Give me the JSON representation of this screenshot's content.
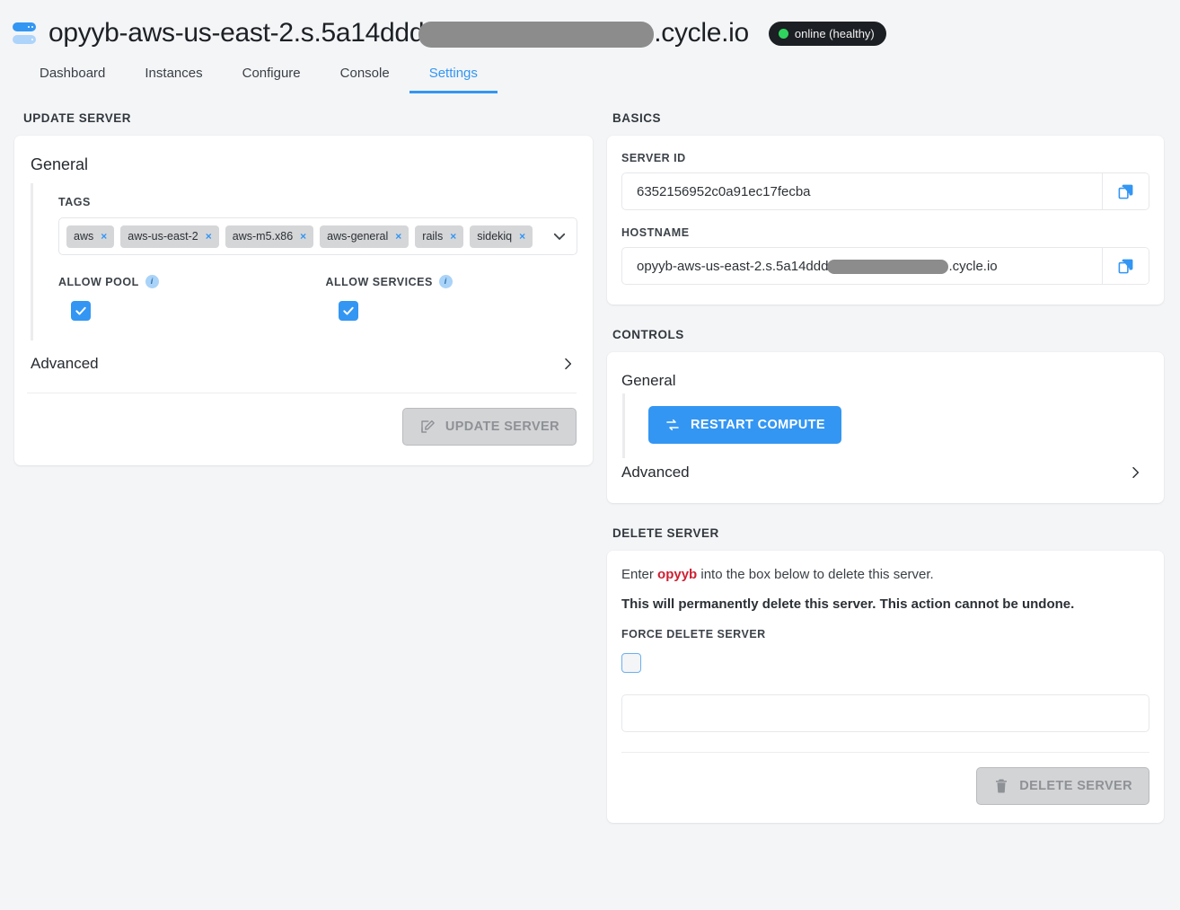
{
  "header": {
    "title_prefix": "opyyb-aws-us-east-2.s.5a14ddd",
    "title_suffix": ".cycle.io",
    "status": "online (healthy)",
    "status_color": "#2fd45e",
    "icon": "server-icon"
  },
  "tabs": [
    {
      "label": "Dashboard",
      "active": false
    },
    {
      "label": "Instances",
      "active": false
    },
    {
      "label": "Configure",
      "active": false
    },
    {
      "label": "Console",
      "active": false
    },
    {
      "label": "Settings",
      "active": true
    }
  ],
  "update_server": {
    "section_title": "UPDATE SERVER",
    "card_heading": "General",
    "tags_label": "TAGS",
    "tags": [
      {
        "label": "aws"
      },
      {
        "label": "aws-us-east-2"
      },
      {
        "label": "aws-m5.x86"
      },
      {
        "label": "aws-general"
      },
      {
        "label": "rails"
      },
      {
        "label": "sidekiq"
      }
    ],
    "tag_remove_glyph": "×",
    "dropdown_icon": "chevron-down-icon",
    "allow_pool_label": "ALLOW POOL",
    "allow_pool_checked": true,
    "allow_services_label": "ALLOW SERVICES",
    "allow_services_checked": true,
    "info_glyph": "i",
    "advanced_label": "Advanced",
    "update_button": "UPDATE SERVER",
    "update_button_disabled": true
  },
  "basics": {
    "section_title": "BASICS",
    "server_id_label": "SERVER ID",
    "server_id_value": "6352156952c0a91ec17fecba",
    "hostname_label": "HOSTNAME",
    "hostname_prefix": "opyyb-aws-us-east-2.s.5a14ddd",
    "hostname_suffix": ".cycle.io",
    "copy_icon": "copy-icon"
  },
  "controls": {
    "section_title": "CONTROLS",
    "heading": "General",
    "restart_button": "RESTART COMPUTE",
    "restart_icon": "sync-icon",
    "advanced_label": "Advanced"
  },
  "delete_server": {
    "section_title": "DELETE SERVER",
    "prompt_prefix": "Enter ",
    "prompt_keyword": "opyyb",
    "prompt_suffix": " into the box below to delete this server.",
    "warning": "This will permanently delete this server. This action cannot be undone.",
    "force_label": "FORCE DELETE SERVER",
    "force_checked": false,
    "confirm_placeholder": "",
    "confirm_value": "",
    "delete_button": "DELETE SERVER",
    "delete_icon": "trash-icon",
    "delete_button_disabled": true
  },
  "colors": {
    "accent": "#3396f3",
    "page_bg": "#f4f5f7",
    "card_bg": "#ffffff",
    "danger": "#cf2033",
    "online": "#2fd45e"
  }
}
